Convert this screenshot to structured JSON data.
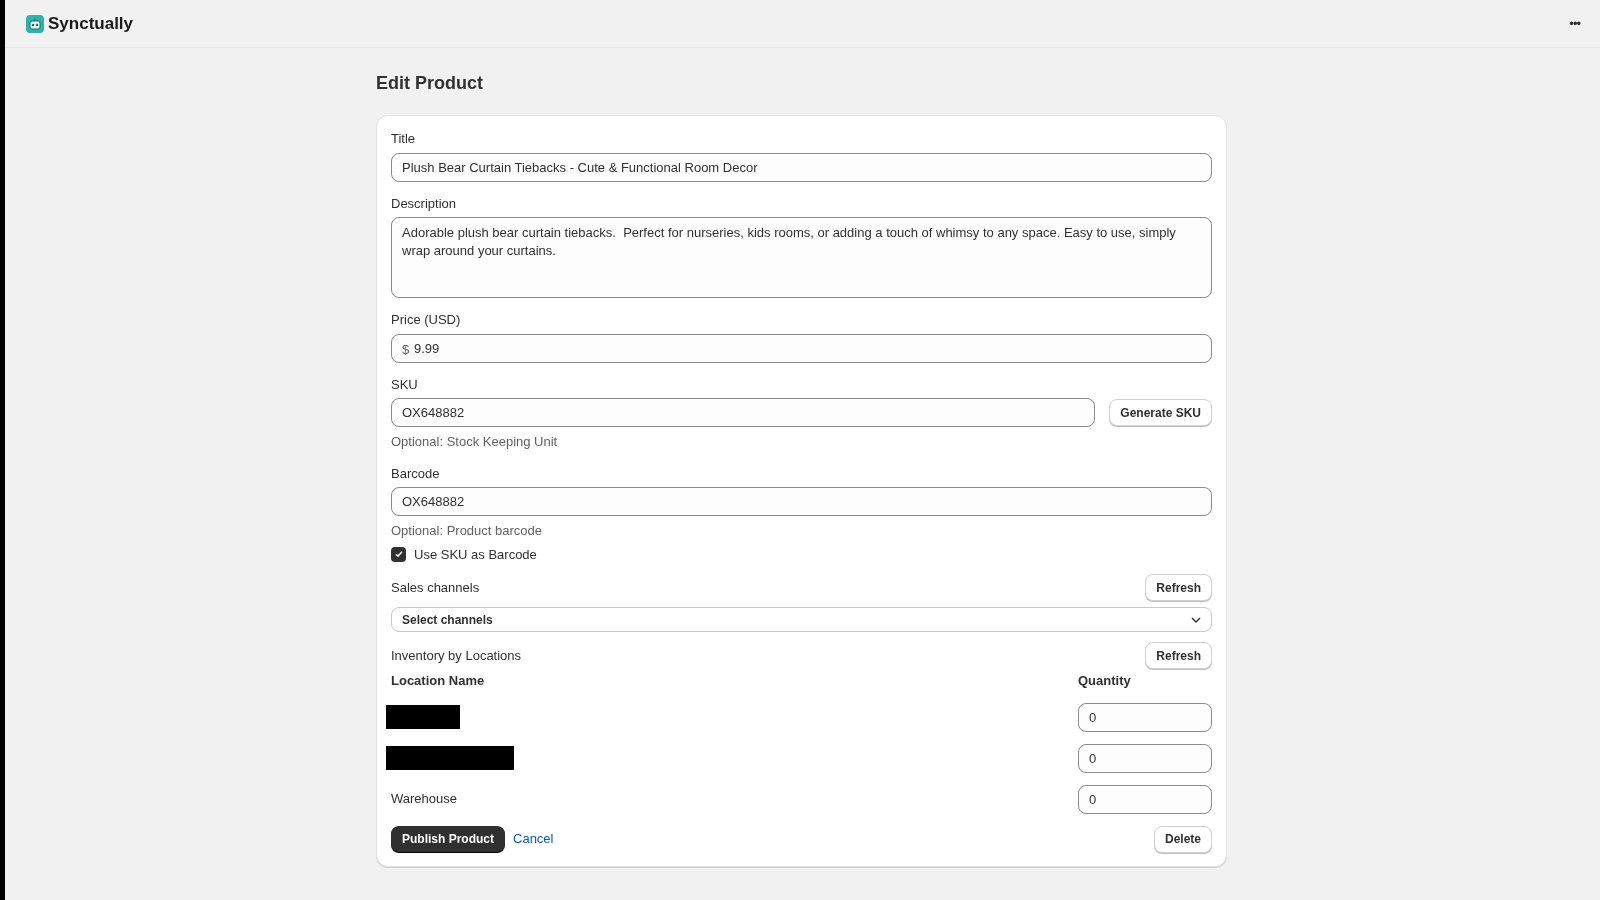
{
  "app": {
    "name": "Synctually",
    "menu": "•••"
  },
  "page_title": "Edit Product",
  "form": {
    "title": {
      "label": "Title",
      "value": "Plush Bear Curtain Tiebacks - Cute & Functional Room Decor"
    },
    "description": {
      "label": "Description",
      "value": "Adorable plush bear curtain tiebacks.  Perfect for nurseries, kids rooms, or adding a touch of whimsy to any space. Easy to use, simply wrap around your curtains."
    },
    "price": {
      "label": "Price (USD)",
      "prefix": "$",
      "value": "9.99"
    },
    "sku": {
      "label": "SKU",
      "value": "OX648882",
      "button": "Generate SKU",
      "help": "Optional: Stock Keeping Unit"
    },
    "barcode": {
      "label": "Barcode",
      "value": "OX648882",
      "help": "Optional: Product barcode"
    },
    "use_sku_as_barcode": {
      "label": "Use SKU as Barcode",
      "checked": true
    },
    "sales_channels": {
      "label": "Sales channels",
      "button": "Refresh",
      "select": "Select channels"
    },
    "inventory": {
      "label": "Inventory by Locations",
      "button": "Refresh",
      "columns": [
        "Location Name",
        "Quantity"
      ],
      "rows": [
        {
          "kind": "redacted",
          "quantity": "0"
        },
        {
          "kind": "redacted",
          "quantity": "0"
        },
        {
          "kind": "text",
          "name": "Warehouse",
          "quantity": "0"
        }
      ]
    },
    "actions": {
      "publish": "Publish Product",
      "cancel": "Cancel",
      "delete": "Delete"
    }
  }
}
